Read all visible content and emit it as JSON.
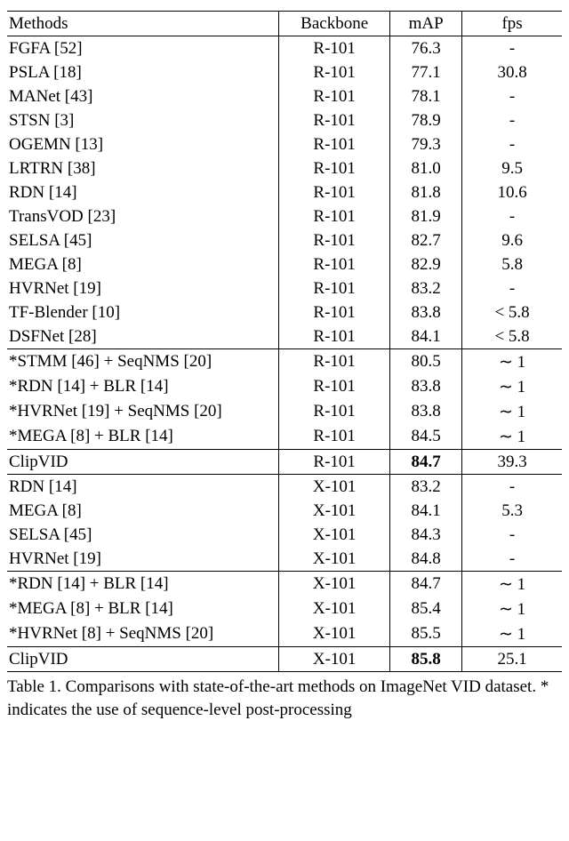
{
  "headers": {
    "method": "Methods",
    "backbone": "Backbone",
    "map": "mAP",
    "fps": "fps"
  },
  "rows": [
    {
      "m": "FGFA [52]",
      "b": "R-101",
      "map": "76.3",
      "fps": "-"
    },
    {
      "m": "PSLA [18]",
      "b": "R-101",
      "map": "77.1",
      "fps": "30.8"
    },
    {
      "m": "MANet [43]",
      "b": "R-101",
      "map": "78.1",
      "fps": "-"
    },
    {
      "m": "STSN [3]",
      "b": "R-101",
      "map": "78.9",
      "fps": "-"
    },
    {
      "m": "OGEMN [13]",
      "b": "R-101",
      "map": "79.3",
      "fps": "-"
    },
    {
      "m": "LRTRN [38]",
      "b": "R-101",
      "map": "81.0",
      "fps": "9.5"
    },
    {
      "m": "RDN [14]",
      "b": "R-101",
      "map": "81.8",
      "fps": "10.6"
    },
    {
      "m": "TransVOD [23]",
      "b": "R-101",
      "map": "81.9",
      "fps": "-"
    },
    {
      "m": "SELSA [45]",
      "b": "R-101",
      "map": "82.7",
      "fps": "9.6"
    },
    {
      "m": "MEGA [8]",
      "b": "R-101",
      "map": "82.9",
      "fps": "5.8"
    },
    {
      "m": "HVRNet [19]",
      "b": "R-101",
      "map": "83.2",
      "fps": "-"
    },
    {
      "m": "TF-Blender [10]",
      "b": "R-101",
      "map": "83.8",
      "fps": "< 5.8"
    },
    {
      "m": "DSFNet [28]",
      "b": "R-101",
      "map": "84.1",
      "fps": "< 5.8"
    },
    {
      "m": "*STMM [46] + SeqNMS [20]",
      "b": "R-101",
      "map": "80.5",
      "fps": "∼ 1",
      "rule": "mid"
    },
    {
      "m": "*RDN [14] + BLR [14]",
      "b": "R-101",
      "map": "83.8",
      "fps": "∼ 1"
    },
    {
      "m": "*HVRNet [19] + SeqNMS [20]",
      "b": "R-101",
      "map": "83.8",
      "fps": "∼ 1"
    },
    {
      "m": "*MEGA [8] + BLR [14]",
      "b": "R-101",
      "map": "84.5",
      "fps": "∼ 1"
    },
    {
      "m": "ClipVID",
      "b": "R-101",
      "map": "84.7",
      "map_bold": true,
      "fps": "39.3",
      "rule": "mid"
    },
    {
      "m": "RDN [14]",
      "b": "X-101",
      "map": "83.2",
      "fps": "-",
      "rule": "mid"
    },
    {
      "m": "MEGA [8]",
      "b": "X-101",
      "map": "84.1",
      "fps": "5.3"
    },
    {
      "m": "SELSA [45]",
      "b": "X-101",
      "map": "84.3",
      "fps": "-"
    },
    {
      "m": "HVRNet [19]",
      "b": "X-101",
      "map": "84.8",
      "fps": "-"
    },
    {
      "m": "*RDN [14] + BLR [14]",
      "b": "X-101",
      "map": "84.7",
      "fps": "∼ 1",
      "rule": "mid"
    },
    {
      "m": "*MEGA [8] + BLR [14]",
      "b": "X-101",
      "map": "85.4",
      "fps": "∼ 1"
    },
    {
      "m": "*HVRNet [8] + SeqNMS [20]",
      "b": "X-101",
      "map": "85.5",
      "fps": "∼ 1"
    },
    {
      "m": "ClipVID",
      "b": "X-101",
      "map": "85.8",
      "map_bold": true,
      "fps": "25.1",
      "rule": "mid",
      "bottom": true
    }
  ],
  "caption": "Table 1. Comparisons with state-of-the-art methods on ImageNet VID dataset. * indicates the use of sequence-level post-processing"
}
